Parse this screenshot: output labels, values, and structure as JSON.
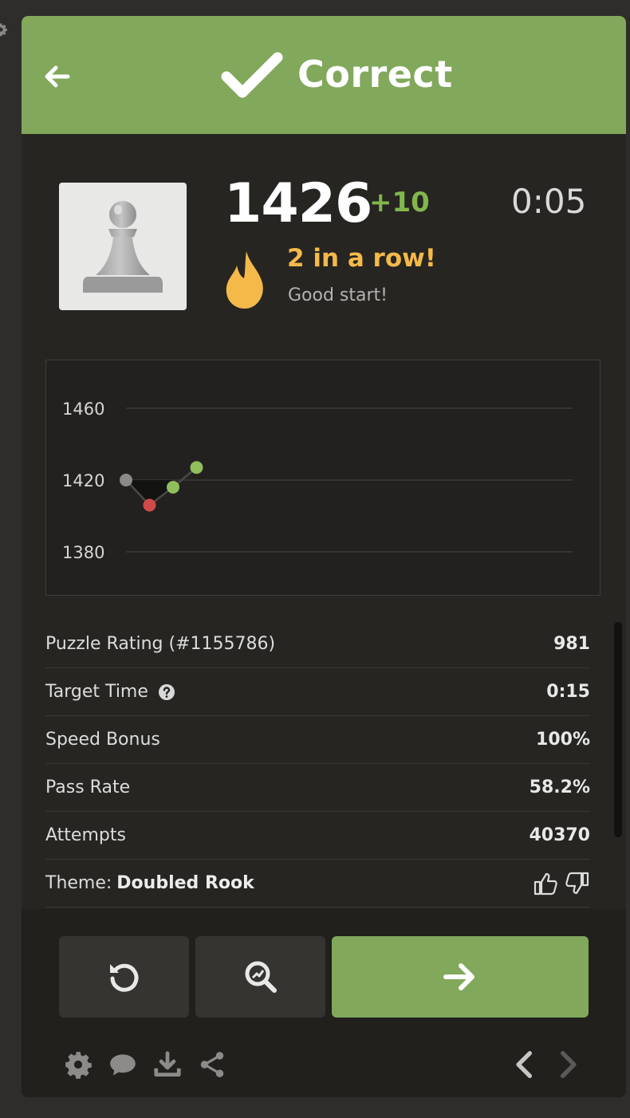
{
  "banner": {
    "title": "Correct",
    "color": "#81a85b"
  },
  "result": {
    "rating": "1426",
    "rating_delta": "+10",
    "timer": "0:05",
    "streak_title": "2 in a row!",
    "streak_subtitle": "Good start!"
  },
  "chart_data": {
    "type": "line",
    "x": [
      1,
      2,
      3,
      4
    ],
    "values": [
      1420,
      1406,
      1416,
      1427
    ],
    "point_colors": [
      "#8a8a8a",
      "#d04a4a",
      "#8fbe5a",
      "#8fbe5a"
    ],
    "ytick_labels": [
      "1460",
      "1420",
      "1380"
    ],
    "ylim": [
      1380,
      1460
    ],
    "grid": true
  },
  "stats": [
    {
      "label": "Puzzle Rating (#1155786)",
      "value": "981"
    },
    {
      "label": "Target Time",
      "value": "0:15"
    },
    {
      "label": "Speed Bonus",
      "value": "100%"
    },
    {
      "label": "Pass Rate",
      "value": "58.2%"
    },
    {
      "label": "Attempts",
      "value": "40370"
    }
  ],
  "theme": {
    "label": "Theme:",
    "name": "Doubled Rook"
  },
  "icons": {
    "back": "arrow-left-icon",
    "check": "checkmark-icon",
    "pawn": "pawn-icon",
    "flame": "flame-icon",
    "help": "question-circle-icon",
    "like": "thumbs-up-icon",
    "dislike": "thumbs-down-icon",
    "retry": "retry-icon",
    "analyze": "analysis-magnifier-icon",
    "next": "arrow-right-icon",
    "settings": "gear-icon",
    "chat": "chat-bubble-icon",
    "download": "download-icon",
    "share": "share-icon",
    "prev_nav": "chevron-left-icon",
    "next_nav": "chevron-right-icon"
  },
  "colors": {
    "streak": "#f5b94a",
    "rating_delta": "#81b64c",
    "next_button": "#81a85b"
  }
}
